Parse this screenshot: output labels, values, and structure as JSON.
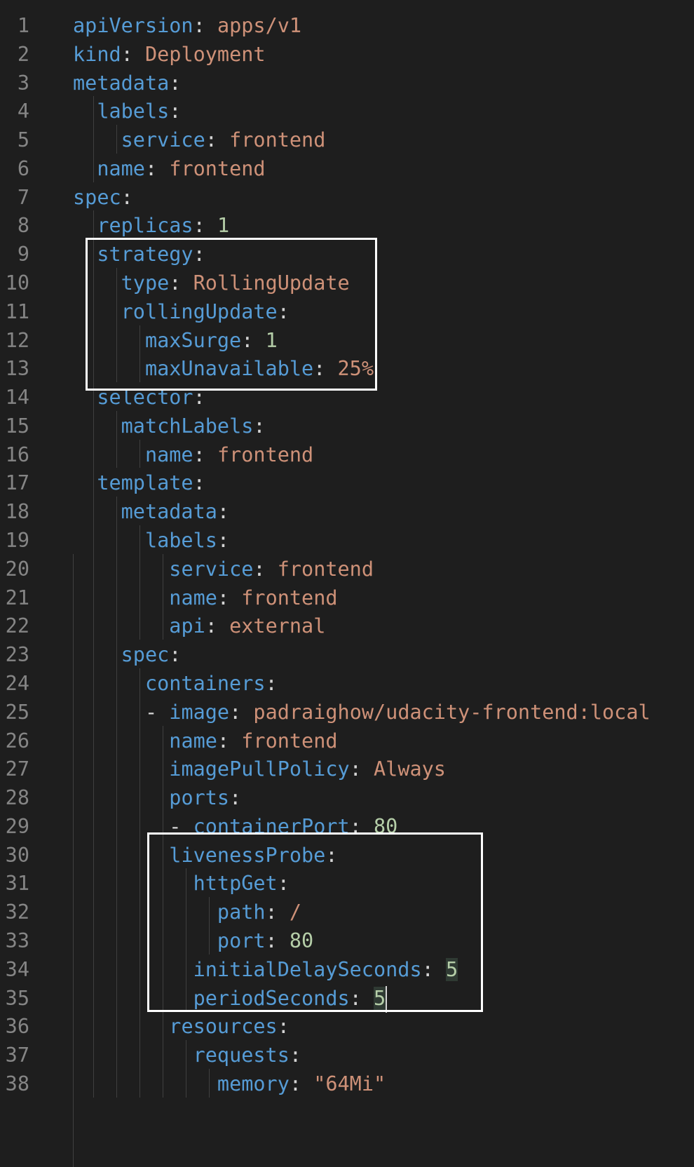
{
  "editor": {
    "lines": [
      {
        "num": "1",
        "indent": "",
        "dash": "",
        "key": "apiVersion",
        "sep": ":",
        "sp": " ",
        "val": "apps/v1",
        "vtype": "s"
      },
      {
        "num": "2",
        "indent": "",
        "dash": "",
        "key": "kind",
        "sep": ":",
        "sp": " ",
        "val": "Deployment",
        "vtype": "s"
      },
      {
        "num": "3",
        "indent": "",
        "dash": "",
        "key": "metadata",
        "sep": ":",
        "sp": "",
        "val": "",
        "vtype": "s"
      },
      {
        "num": "4",
        "indent": "  ",
        "dash": "",
        "key": "labels",
        "sep": ":",
        "sp": "",
        "val": "",
        "vtype": "s"
      },
      {
        "num": "5",
        "indent": "    ",
        "dash": "",
        "key": "service",
        "sep": ":",
        "sp": " ",
        "val": "frontend",
        "vtype": "s"
      },
      {
        "num": "6",
        "indent": "  ",
        "dash": "",
        "key": "name",
        "sep": ":",
        "sp": " ",
        "val": "frontend",
        "vtype": "s"
      },
      {
        "num": "7",
        "indent": "",
        "dash": "",
        "key": "spec",
        "sep": ":",
        "sp": "",
        "val": "",
        "vtype": "s"
      },
      {
        "num": "8",
        "indent": "  ",
        "dash": "",
        "key": "replicas",
        "sep": ":",
        "sp": " ",
        "val": "1",
        "vtype": "n"
      },
      {
        "num": "9",
        "indent": "  ",
        "dash": "",
        "key": "strategy",
        "sep": ":",
        "sp": "",
        "val": "",
        "vtype": "s"
      },
      {
        "num": "10",
        "indent": "    ",
        "dash": "",
        "key": "type",
        "sep": ":",
        "sp": " ",
        "val": "RollingUpdate",
        "vtype": "s"
      },
      {
        "num": "11",
        "indent": "    ",
        "dash": "",
        "key": "rollingUpdate",
        "sep": ":",
        "sp": "",
        "val": "",
        "vtype": "s"
      },
      {
        "num": "12",
        "indent": "      ",
        "dash": "",
        "key": "maxSurge",
        "sep": ":",
        "sp": " ",
        "val": "1",
        "vtype": "n"
      },
      {
        "num": "13",
        "indent": "      ",
        "dash": "",
        "key": "maxUnavailable",
        "sep": ":",
        "sp": " ",
        "val": "25%",
        "vtype": "s"
      },
      {
        "num": "14",
        "indent": "  ",
        "dash": "",
        "key": "selector",
        "sep": ":",
        "sp": "",
        "val": "",
        "vtype": "s"
      },
      {
        "num": "15",
        "indent": "    ",
        "dash": "",
        "key": "matchLabels",
        "sep": ":",
        "sp": "",
        "val": "",
        "vtype": "s"
      },
      {
        "num": "16",
        "indent": "      ",
        "dash": "",
        "key": "name",
        "sep": ":",
        "sp": " ",
        "val": "frontend",
        "vtype": "s"
      },
      {
        "num": "17",
        "indent": "  ",
        "dash": "",
        "key": "template",
        "sep": ":",
        "sp": "",
        "val": "",
        "vtype": "s"
      },
      {
        "num": "18",
        "indent": "    ",
        "dash": "",
        "key": "metadata",
        "sep": ":",
        "sp": "",
        "val": "",
        "vtype": "s"
      },
      {
        "num": "19",
        "indent": "      ",
        "dash": "",
        "key": "labels",
        "sep": ":",
        "sp": "",
        "val": "",
        "vtype": "s"
      },
      {
        "num": "20",
        "indent": "        ",
        "dash": "",
        "key": "service",
        "sep": ":",
        "sp": " ",
        "val": "frontend",
        "vtype": "s"
      },
      {
        "num": "21",
        "indent": "        ",
        "dash": "",
        "key": "name",
        "sep": ":",
        "sp": " ",
        "val": "frontend",
        "vtype": "s"
      },
      {
        "num": "22",
        "indent": "        ",
        "dash": "",
        "key": "api",
        "sep": ":",
        "sp": " ",
        "val": "external",
        "vtype": "s"
      },
      {
        "num": "23",
        "indent": "    ",
        "dash": "",
        "key": "spec",
        "sep": ":",
        "sp": "",
        "val": "",
        "vtype": "s"
      },
      {
        "num": "24",
        "indent": "      ",
        "dash": "",
        "key": "containers",
        "sep": ":",
        "sp": "",
        "val": "",
        "vtype": "s"
      },
      {
        "num": "25",
        "indent": "      ",
        "dash": "- ",
        "key": "image",
        "sep": ":",
        "sp": " ",
        "val": "padraighow/udacity-frontend:local",
        "vtype": "s"
      },
      {
        "num": "26",
        "indent": "        ",
        "dash": "",
        "key": "name",
        "sep": ":",
        "sp": " ",
        "val": "frontend",
        "vtype": "s"
      },
      {
        "num": "27",
        "indent": "        ",
        "dash": "",
        "key": "imagePullPolicy",
        "sep": ":",
        "sp": " ",
        "val": "Always",
        "vtype": "s"
      },
      {
        "num": "28",
        "indent": "        ",
        "dash": "",
        "key": "ports",
        "sep": ":",
        "sp": "",
        "val": "",
        "vtype": "s"
      },
      {
        "num": "29",
        "indent": "        ",
        "dash": "- ",
        "key": "containerPort",
        "sep": ":",
        "sp": " ",
        "val": "80",
        "vtype": "n"
      },
      {
        "num": "30",
        "indent": "        ",
        "dash": "",
        "key": "livenessProbe",
        "sep": ":",
        "sp": "",
        "val": "",
        "vtype": "s"
      },
      {
        "num": "31",
        "indent": "          ",
        "dash": "",
        "key": "httpGet",
        "sep": ":",
        "sp": "",
        "val": "",
        "vtype": "s"
      },
      {
        "num": "32",
        "indent": "            ",
        "dash": "",
        "key": "path",
        "sep": ":",
        "sp": " ",
        "val": "/",
        "vtype": "s"
      },
      {
        "num": "33",
        "indent": "            ",
        "dash": "",
        "key": "port",
        "sep": ":",
        "sp": " ",
        "val": "80",
        "vtype": "n"
      },
      {
        "num": "34",
        "indent": "          ",
        "dash": "",
        "key": "initialDelaySeconds",
        "sep": ":",
        "sp": " ",
        "val": "5",
        "vtype": "n",
        "highlight": true
      },
      {
        "num": "35",
        "indent": "          ",
        "dash": "",
        "key": "periodSeconds",
        "sep": ":",
        "sp": " ",
        "val": "5",
        "vtype": "n",
        "highlight": true,
        "cursor": true
      },
      {
        "num": "36",
        "indent": "        ",
        "dash": "",
        "key": "resources",
        "sep": ":",
        "sp": "",
        "val": "",
        "vtype": "s"
      },
      {
        "num": "37",
        "indent": "          ",
        "dash": "",
        "key": "requests",
        "sep": ":",
        "sp": "",
        "val": "",
        "vtype": "s"
      },
      {
        "num": "38",
        "indent": "            ",
        "dash": "",
        "key": "memory",
        "sep": ":",
        "sp": " ",
        "val": "\"64Mi\"",
        "vtype": "s"
      }
    ]
  },
  "colors": {
    "background": "#1e1e1e",
    "line_number": "#858585",
    "key": "#569cd6",
    "string": "#ce9178",
    "number": "#b5cea8",
    "annotation_box": "#ffffff"
  }
}
